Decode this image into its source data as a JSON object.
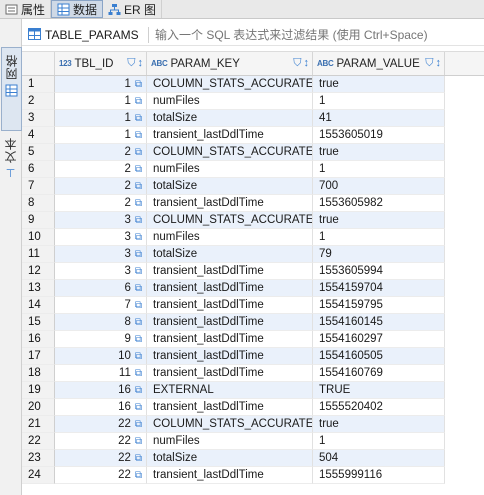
{
  "tabs": [
    {
      "label": "属性",
      "icon": "properties-icon"
    },
    {
      "label": "数据",
      "icon": "data-grid-icon"
    },
    {
      "label": "ER 图",
      "icon": "er-diagram-icon"
    }
  ],
  "side": {
    "grid_label": "网格",
    "text_label": "文本"
  },
  "filter": {
    "table_name": "TABLE_PARAMS",
    "placeholder": "输入一个 SQL 表达式来过滤结果 (使用 Ctrl+Space)"
  },
  "columns": [
    {
      "type": "123",
      "name": "TBL_ID"
    },
    {
      "type": "ABC",
      "name": "PARAM_KEY"
    },
    {
      "type": "ABC",
      "name": "PARAM_VALUE"
    }
  ],
  "rows": [
    {
      "n": "1",
      "id": "1",
      "key": "COLUMN_STATS_ACCURATE",
      "val": "true"
    },
    {
      "n": "2",
      "id": "1",
      "key": "numFiles",
      "val": "1"
    },
    {
      "n": "3",
      "id": "1",
      "key": "totalSize",
      "val": "41"
    },
    {
      "n": "4",
      "id": "1",
      "key": "transient_lastDdlTime",
      "val": "1553605019"
    },
    {
      "n": "5",
      "id": "2",
      "key": "COLUMN_STATS_ACCURATE",
      "val": "true"
    },
    {
      "n": "6",
      "id": "2",
      "key": "numFiles",
      "val": "1"
    },
    {
      "n": "7",
      "id": "2",
      "key": "totalSize",
      "val": "700"
    },
    {
      "n": "8",
      "id": "2",
      "key": "transient_lastDdlTime",
      "val": "1553605982"
    },
    {
      "n": "9",
      "id": "3",
      "key": "COLUMN_STATS_ACCURATE",
      "val": "true"
    },
    {
      "n": "10",
      "id": "3",
      "key": "numFiles",
      "val": "1"
    },
    {
      "n": "11",
      "id": "3",
      "key": "totalSize",
      "val": "79"
    },
    {
      "n": "12",
      "id": "3",
      "key": "transient_lastDdlTime",
      "val": "1553605994"
    },
    {
      "n": "13",
      "id": "6",
      "key": "transient_lastDdlTime",
      "val": "1554159704"
    },
    {
      "n": "14",
      "id": "7",
      "key": "transient_lastDdlTime",
      "val": "1554159795"
    },
    {
      "n": "15",
      "id": "8",
      "key": "transient_lastDdlTime",
      "val": "1554160145"
    },
    {
      "n": "16",
      "id": "9",
      "key": "transient_lastDdlTime",
      "val": "1554160297"
    },
    {
      "n": "17",
      "id": "10",
      "key": "transient_lastDdlTime",
      "val": "1554160505"
    },
    {
      "n": "18",
      "id": "11",
      "key": "transient_lastDdlTime",
      "val": "1554160769"
    },
    {
      "n": "19",
      "id": "16",
      "key": "EXTERNAL",
      "val": "TRUE"
    },
    {
      "n": "20",
      "id": "16",
      "key": "transient_lastDdlTime",
      "val": "1555520402"
    },
    {
      "n": "21",
      "id": "22",
      "key": "COLUMN_STATS_ACCURATE",
      "val": "true"
    },
    {
      "n": "22",
      "id": "22",
      "key": "numFiles",
      "val": "1"
    },
    {
      "n": "23",
      "id": "22",
      "key": "totalSize",
      "val": "504"
    },
    {
      "n": "24",
      "id": "22",
      "key": "transient_lastDdlTime",
      "val": "1555999116"
    }
  ],
  "colors": {
    "accent": "#3a7fd0",
    "row_alt": "#eaf1fb",
    "active_tab": "#cfd9e6"
  }
}
